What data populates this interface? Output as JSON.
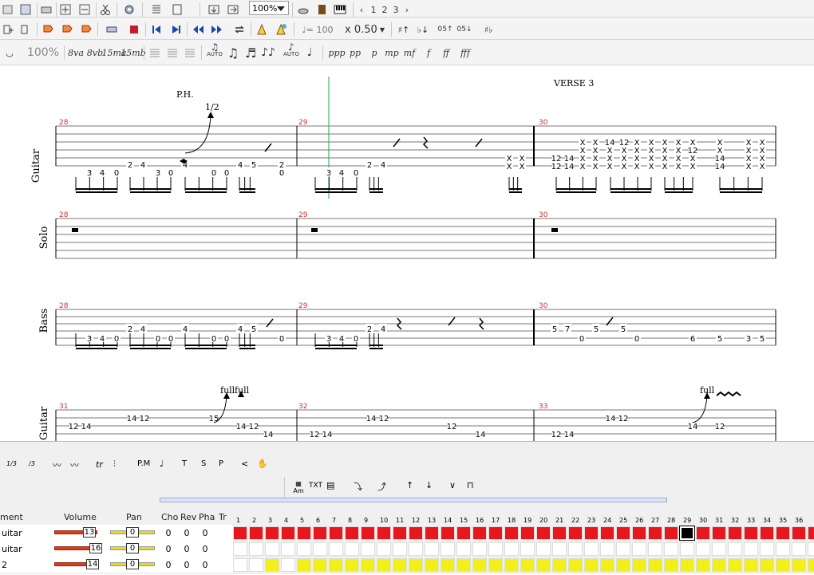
{
  "toolbar": {
    "zoom": "100%",
    "page_tabs": [
      "1",
      "2",
      "3"
    ],
    "tempo": "= 100",
    "speed": "x 0.50",
    "zoom_secondary": "100%",
    "octave_labels": [
      "8va",
      "8vb",
      "15ma",
      "15mb"
    ],
    "dynamics": [
      "ppp",
      "pp",
      "p",
      "mp",
      "mf",
      "f",
      "ff",
      "fff"
    ],
    "auto_labels": [
      "AUTO",
      "AUTO"
    ],
    "effects_row": [
      "1/3",
      "/3",
      "tr",
      "P.M",
      "T",
      "S",
      "P"
    ],
    "chord_label": "Am",
    "txt_label": "TXT"
  },
  "score": {
    "section_label": "VERSE 3",
    "ph_label": "P.H.",
    "bend_label": "1/2",
    "full_label": "full",
    "tracks": [
      "Guitar",
      "Solo",
      "Bass"
    ],
    "bar_numbers_top": [
      "28",
      "29",
      "30"
    ],
    "bar_numbers_bottom": [
      "31",
      "32",
      "33"
    ],
    "guitar_bar28": [
      "3",
      "4",
      "0",
      "2",
      "4",
      "3",
      "0",
      "4",
      "0",
      "0",
      "4",
      "5",
      "0",
      "2"
    ],
    "guitar_bar29": [
      "3",
      "4",
      "0",
      "2",
      "4"
    ],
    "bass_bar28": [
      "3",
      "4",
      "0",
      "2",
      "4",
      "0",
      "0",
      "4",
      "0",
      "0",
      "4",
      "5",
      "0"
    ],
    "bass_bar29": [
      "3",
      "4",
      "0",
      "2",
      "4"
    ],
    "bass_bar30": [
      "5",
      "7",
      "0",
      "5",
      "5",
      "0",
      "6",
      "5",
      "3",
      "5"
    ]
  },
  "mixer": {
    "headers": [
      "ment",
      "Volume",
      "Pan",
      "Cho",
      "Rev",
      "Pha",
      "Tr"
    ],
    "rows": [
      {
        "name": "uitar",
        "volume": "13",
        "pan": "0",
        "cho": "0",
        "rev": "0",
        "pha": "0"
      },
      {
        "name": "uitar",
        "volume": "16",
        "pan": "0",
        "cho": "0",
        "rev": "0",
        "pha": "0"
      },
      {
        "name": "2",
        "volume": "14",
        "pan": "0",
        "cho": "0",
        "rev": "0",
        "pha": "0"
      }
    ],
    "measure_numbers": [
      "1",
      "2",
      "3",
      "4",
      "5",
      "6",
      "7",
      "8",
      "9",
      "10",
      "11",
      "12",
      "13",
      "14",
      "15",
      "16",
      "17",
      "18",
      "19",
      "20",
      "21",
      "22",
      "23",
      "24",
      "25",
      "26",
      "27",
      "28",
      "29",
      "30",
      "31",
      "32",
      "33",
      "34",
      "35",
      "36"
    ],
    "current_measure": 29,
    "colors": {
      "track1": "#e8171c",
      "track3": "#f3ef1a",
      "empty": "#ffffff"
    }
  }
}
